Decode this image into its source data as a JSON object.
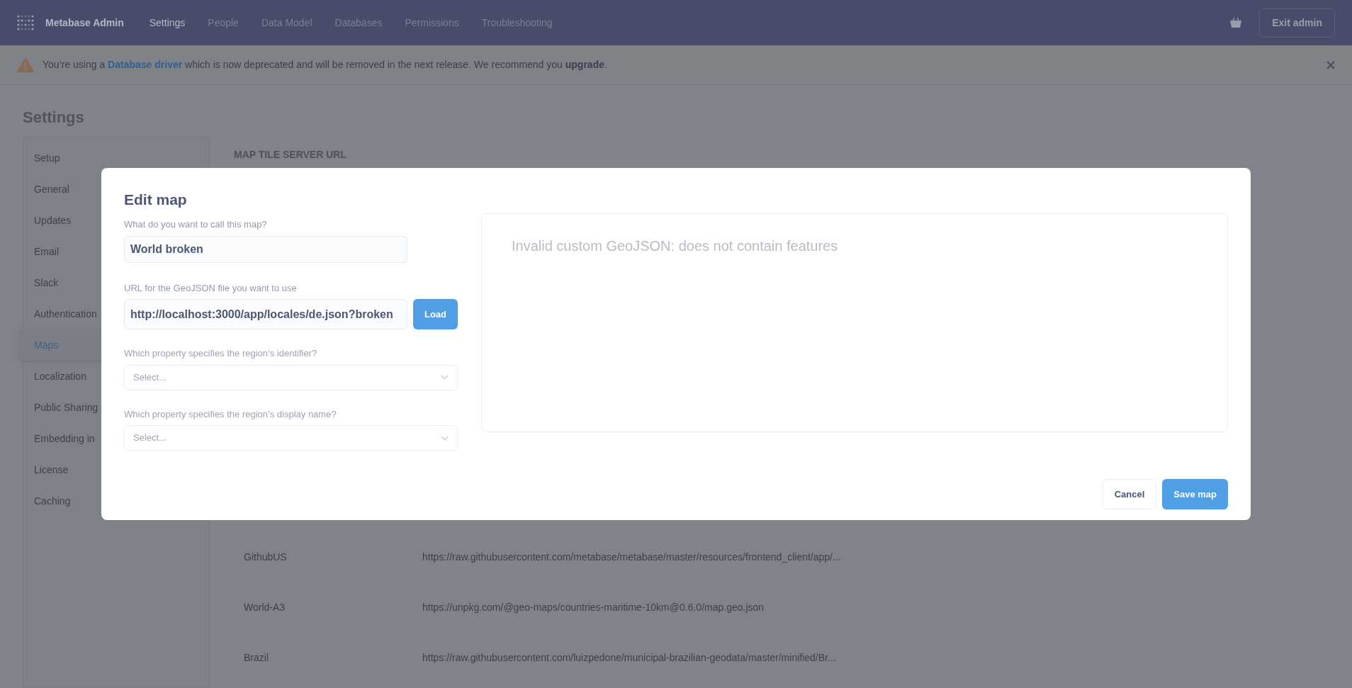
{
  "top_nav": {
    "brand": "Metabase Admin",
    "items": [
      {
        "label": "Settings",
        "selected": true
      },
      {
        "label": "People",
        "selected": false
      },
      {
        "label": "Data Model",
        "selected": false
      },
      {
        "label": "Databases",
        "selected": false
      },
      {
        "label": "Permissions",
        "selected": false
      },
      {
        "label": "Troubleshooting",
        "selected": false
      }
    ],
    "exit_button": "Exit admin"
  },
  "banner": {
    "segments": [
      {
        "kind": "plain",
        "text": "You’re using a "
      },
      {
        "kind": "link",
        "text": "Database driver"
      },
      {
        "kind": "plain",
        "text": " which is now deprecated and will be removed in the next release. We recommend you "
      },
      {
        "kind": "bold",
        "text": "upgrade"
      },
      {
        "kind": "plain",
        "text": "."
      }
    ]
  },
  "settings": {
    "title": "Settings",
    "sidebar": [
      {
        "label": "Setup",
        "selected": false
      },
      {
        "label": "General",
        "selected": false
      },
      {
        "label": "Updates",
        "selected": false
      },
      {
        "label": "Email",
        "selected": false
      },
      {
        "label": "Slack",
        "selected": false
      },
      {
        "label": "Authentication",
        "selected": false
      },
      {
        "label": "Maps",
        "selected": true
      },
      {
        "label": "Localization",
        "selected": false
      },
      {
        "label": "Public Sharing",
        "selected": false
      },
      {
        "label": "Embedding in",
        "selected": false
      },
      {
        "label": "License",
        "selected": false
      },
      {
        "label": "Caching",
        "selected": false
      }
    ],
    "section_label": "MAP TILE SERVER URL",
    "maps": [
      {
        "name": "GithubUS",
        "url": "https://raw.githubusercontent.com/metabase/metabase/master/resources/frontend_client/app/..."
      },
      {
        "name": "World-A3",
        "url": "https://unpkg.com/@geo-maps/countries-maritime-10km@0.6.0/map.geo.json"
      },
      {
        "name": "Brazil",
        "url": "https://raw.githubusercontent.com/luizpedone/municipal-brazilian-geodata/master/minified/Br..."
      }
    ]
  },
  "modal": {
    "title": "Edit map",
    "name_field": {
      "label": "What do you want to call this map?",
      "value": "World broken"
    },
    "url_field": {
      "label": "URL for the GeoJSON file you want to use",
      "value": "http://localhost:3000/app/locales/de.json?broken",
      "button": "Load"
    },
    "selects": [
      {
        "label": "Which property specifies the region’s identifier?",
        "placeholder": "Select...",
        "disabled": true
      },
      {
        "label": "Which property specifies the region’s display name?",
        "placeholder": "Select...",
        "disabled": true
      }
    ],
    "preview_message": "Invalid custom GeoJSON: does not contain features",
    "cancel_button": "Cancel",
    "save_button": "Save map"
  }
}
